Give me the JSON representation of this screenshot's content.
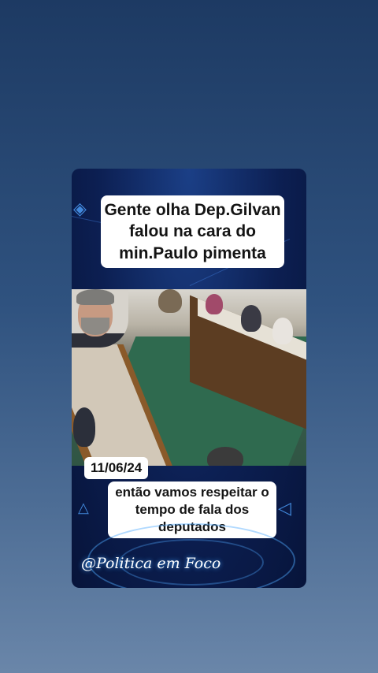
{
  "post": {
    "caption_top": "Gente olha Dep.Gilvan falou na cara do min.Paulo pimenta",
    "date": "11/06/24",
    "caption_bottom": "então vamos respeitar o tempo de fala dos deputados",
    "watermark": "@Politica em Foco"
  },
  "colors": {
    "background_top": "#1d3a63",
    "background_bottom": "#6a86a9",
    "card_bg": "#0c1f52",
    "accent": "#3f7ad8"
  },
  "icons": [
    "triangle-icon",
    "play-triangle-icon"
  ]
}
